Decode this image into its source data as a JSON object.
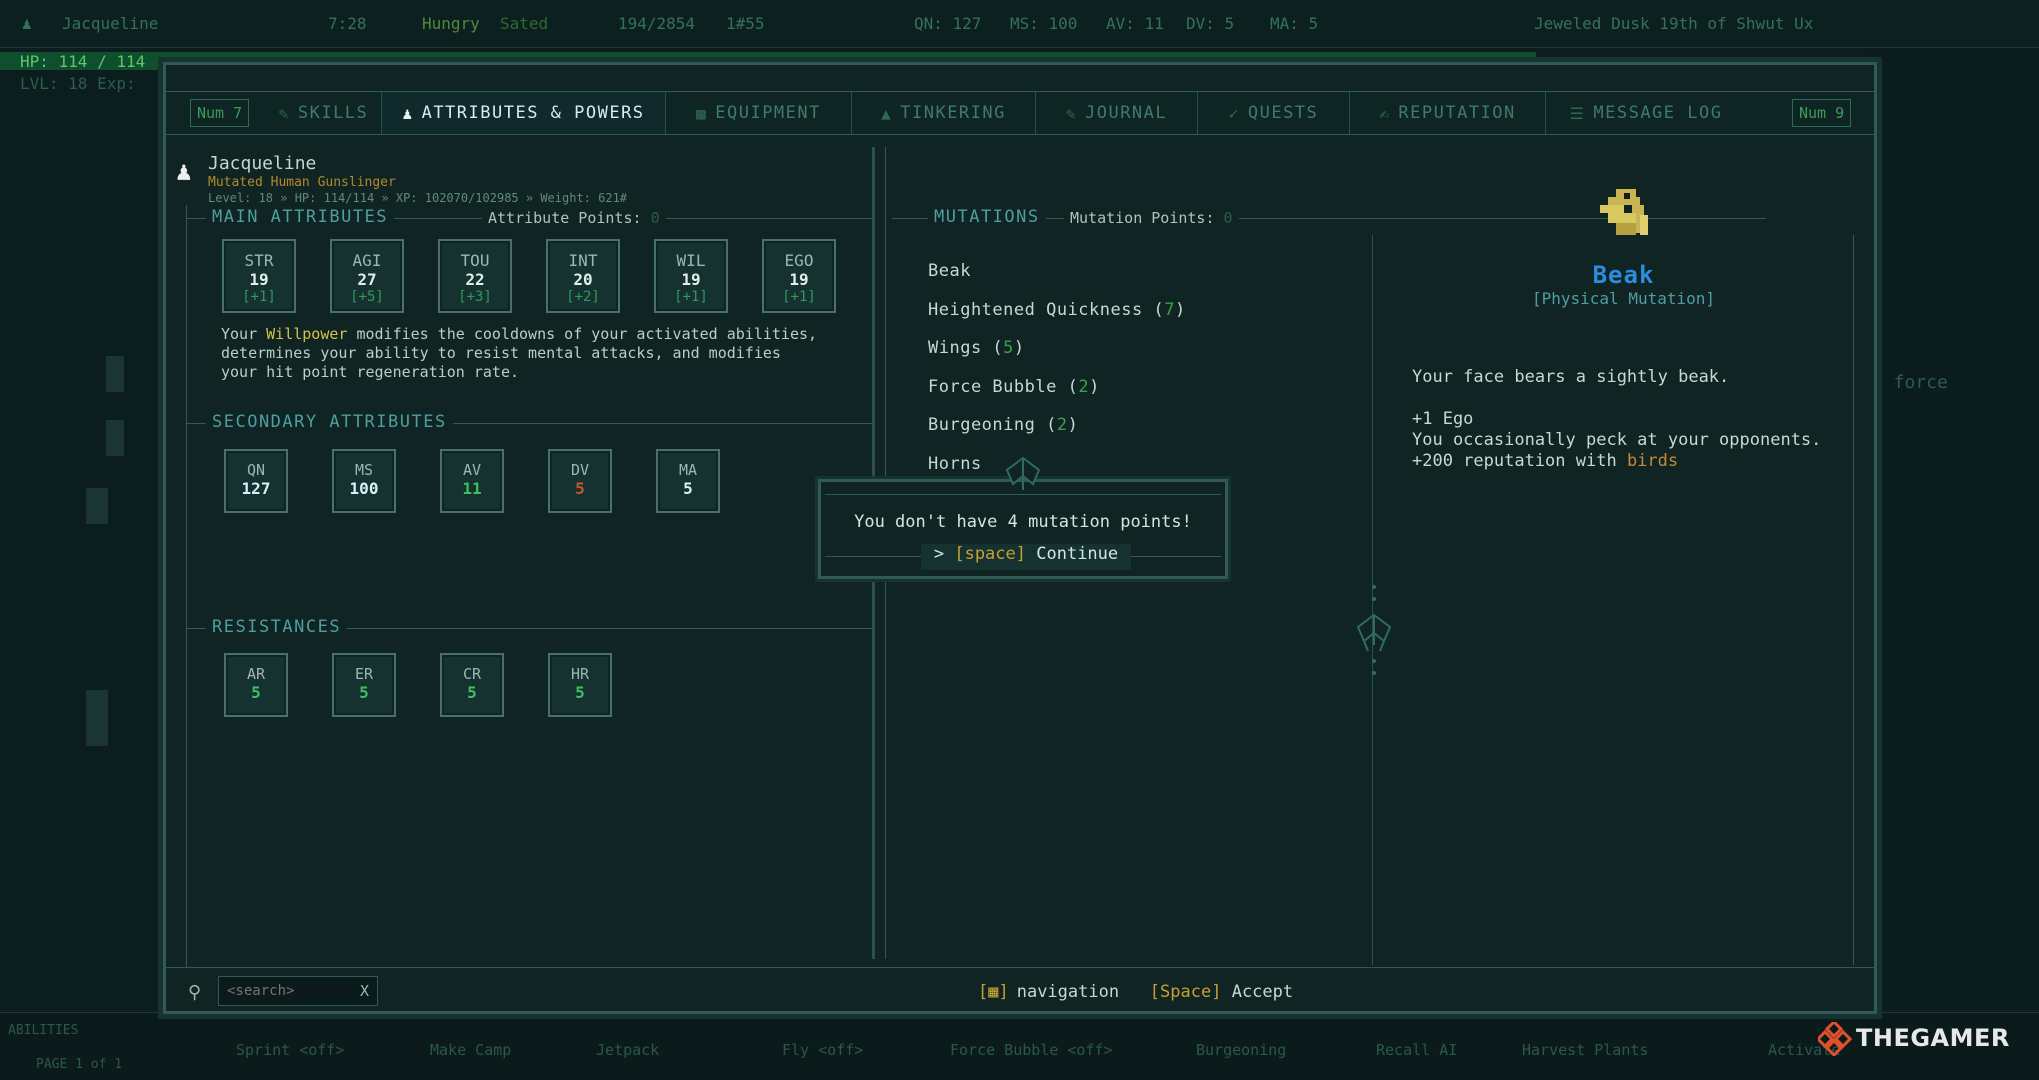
{
  "hud": {
    "name": "Jacqueline",
    "time": "7:28",
    "hunger": "Hungry",
    "hydration": "Sated",
    "weight": "194/2854",
    "money": "1#55",
    "qn": "QN: 127",
    "ms": "MS: 100",
    "av": "AV: 11",
    "dv": "DV: 5",
    "ma": "MA: 5",
    "date": "Jeweled Dusk 19th of Shwut Ux",
    "hp": "HP: 114 / 114",
    "level": "LVL: 18 Exp:",
    "right_text": "a force",
    "hotbar": [
      "Sprint <off>",
      "Make Camp",
      "Jetpack",
      "Fly <off>",
      "Force Bubble <off>",
      "Burgeoning",
      "Recall AI",
      "Harvest Plants",
      "Activate"
    ],
    "abilities_label": "ABILITIES",
    "page_label": "PAGE 1 of 1"
  },
  "watermark": "THEGAMER",
  "tabs": {
    "prev_key": "Num 7",
    "next_key": "Num 9",
    "items": [
      "SKILLS",
      "ATTRIBUTES & POWERS",
      "EQUIPMENT",
      "TINKERING",
      "JOURNAL",
      "QUESTS",
      "REPUTATION",
      "MESSAGE LOG"
    ]
  },
  "character": {
    "name": "Jacqueline",
    "class": "Mutated Human Gunslinger",
    "stats": "Level: 18 » HP: 114/114 » XP: 102070/102985 » Weight: 621#"
  },
  "main_attributes": {
    "title": "MAIN ATTRIBUTES",
    "points_label": "Attribute Points:",
    "points_value": "0",
    "items": [
      {
        "label": "STR",
        "value": "19",
        "bonus": "[+1]"
      },
      {
        "label": "AGI",
        "value": "27",
        "bonus": "[+5]"
      },
      {
        "label": "TOU",
        "value": "22",
        "bonus": "[+3]"
      },
      {
        "label": "INT",
        "value": "20",
        "bonus": "[+2]"
      },
      {
        "label": "WIL",
        "value": "19",
        "bonus": "[+1]"
      },
      {
        "label": "EGO",
        "value": "19",
        "bonus": "[+1]"
      }
    ],
    "desc_pre": "Your ",
    "desc_highlight": "Willpower",
    "desc_post": " modifies the cooldowns of your activated abilities, determines your ability to resist mental attacks, and modifies your hit point regeneration rate."
  },
  "secondary_attributes": {
    "title": "SECONDARY ATTRIBUTES",
    "items": [
      {
        "label": "QN",
        "value": "127",
        "color": "#d8f0f8"
      },
      {
        "label": "MS",
        "value": "100",
        "color": "#d8f0f8"
      },
      {
        "label": "AV",
        "value": "11",
        "color": "#3ec060"
      },
      {
        "label": "DV",
        "value": "5",
        "color": "#c8552e"
      },
      {
        "label": "MA",
        "value": "5",
        "color": "#d8f0f8"
      }
    ]
  },
  "resistances": {
    "title": "RESISTANCES",
    "items": [
      {
        "label": "AR",
        "value": "5",
        "color": "#3ec060"
      },
      {
        "label": "ER",
        "value": "5",
        "color": "#3ec060"
      },
      {
        "label": "CR",
        "value": "5",
        "color": "#3ec060"
      },
      {
        "label": "HR",
        "value": "5",
        "color": "#3ec060"
      }
    ]
  },
  "mutations": {
    "title": "MUTATIONS",
    "points_label": "Mutation Points:",
    "points_value": "0",
    "items": [
      {
        "name": "Beak",
        "level": ""
      },
      {
        "name": "Heightened Quickness",
        "level": "7"
      },
      {
        "name": "Wings",
        "level": "5"
      },
      {
        "name": "Force Bubble",
        "level": "2"
      },
      {
        "name": "Burgeoning",
        "level": "2"
      },
      {
        "name": "Horns",
        "level": ""
      }
    ]
  },
  "detail": {
    "title": "Beak",
    "subtitle": "[Physical Mutation]",
    "description": "Your face bears a sightly beak.",
    "effects": [
      "+1 Ego",
      "You occasionally peck at your opponents."
    ],
    "reputation_pre": "+200 reputation with ",
    "reputation_highlight": "birds"
  },
  "dialog": {
    "message": "You don't have 4 mutation points!",
    "button_arrow": ">",
    "button_key": "[space]",
    "button_label": "Continue"
  },
  "footer": {
    "search_placeholder": "<search>",
    "clear_label": "X",
    "nav_label": "navigation",
    "accept_key": "[Space]",
    "accept_label": "Accept"
  },
  "colors": {
    "panel_bg": "#0f2423",
    "border": "#2f5a55",
    "accent_blue": "#2a8de0",
    "highlight_yellow": "#d6c04a",
    "key_gold": "#c8a032",
    "level_green": "#3aa04c"
  }
}
